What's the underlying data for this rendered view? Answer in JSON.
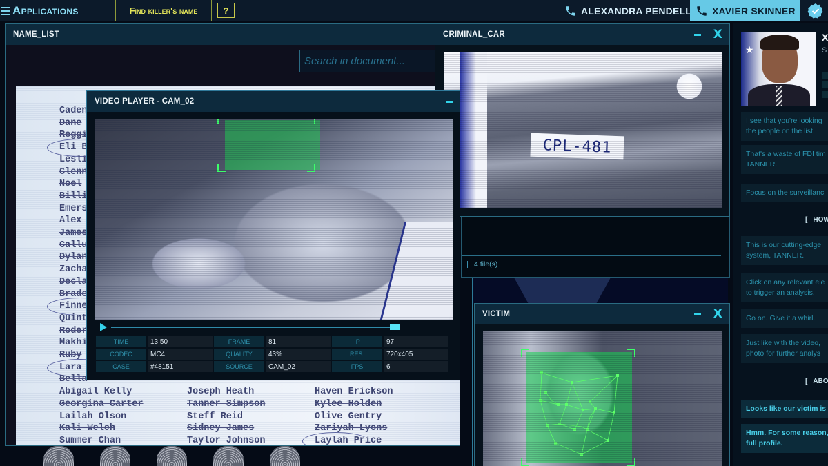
{
  "topbar": {
    "apps_label": "Applications",
    "task_label": "Find killer's name",
    "help_label": "?",
    "contacts": [
      {
        "name": "ALEXANDRA PENDELL",
        "active": false
      },
      {
        "name": "XAVIER SKINNER",
        "active": true
      }
    ],
    "accent_color": "#66c9e6",
    "task_color": "#e4e55a"
  },
  "name_list_window": {
    "title": "NAME_LIST",
    "search_placeholder": "Search in document...",
    "names_column_1": [
      "Caden",
      "Dane",
      "Reggi",
      "Eli B",
      "Lesli",
      "Glenn",
      "Noel",
      "Billi",
      "Emers",
      "Alex",
      "James",
      "Callu",
      "Dylan",
      "Zacha",
      "Decla",
      "Brade",
      "Finne",
      "Quint",
      "Roder",
      "Makhi",
      "Ruby",
      "Lara",
      "Bella"
    ],
    "circled_column_1": [
      "Eli B",
      "Finne",
      "Lara"
    ],
    "bottom_rows": [
      [
        "Abigail Kelly",
        "Joseph Heath",
        "Haven Erickson"
      ],
      [
        "Georgina Carter",
        "Tanner Simpson",
        "Kylee Holden"
      ],
      [
        "Lailah Olson",
        "Steff Reid",
        "Olive Gentry"
      ],
      [
        "Kali Welch",
        "Sidney James",
        "Zariyah Lyons"
      ],
      [
        "Summer Chan",
        "Taylor Johnson",
        "Laylah Price"
      ]
    ],
    "circled_bottom": [
      "Laylah Price"
    ]
  },
  "video_player": {
    "title": "VIDEO PLAYER - CAM_02",
    "progress": 1.0,
    "meta": [
      {
        "label": "TIME",
        "value": "13:50"
      },
      {
        "label": "FRAME",
        "value": "81"
      },
      {
        "label": "IP",
        "value": "97"
      },
      {
        "label": "CODEC",
        "value": "MC4"
      },
      {
        "label": "QUALITY",
        "value": "43%"
      },
      {
        "label": "RES.",
        "value": "720x405"
      },
      {
        "label": "CASE",
        "value": "#48151"
      },
      {
        "label": "SOURCE",
        "value": "CAM_02"
      },
      {
        "label": "FPS",
        "value": "6"
      }
    ]
  },
  "criminal_car_window": {
    "title": "CRIMINAL_CAR",
    "plate": "CPL-481",
    "minimize": "–",
    "close": "X"
  },
  "files_panel": {
    "count_label": "4 file(s)"
  },
  "victim_window": {
    "title": "VICTIM",
    "minimize": "–",
    "close": "X"
  },
  "chat": {
    "profile_name": "X",
    "profile_subtitle": "S",
    "messages_1": [
      "I see that you're looking\nthe people on the list.",
      "That's a waste of FDI tim\nTANNER.",
      "Focus on the surveillanc"
    ],
    "section_1": "HOW",
    "messages_2": [
      "This is our cutting-edge\nsystem, TANNER.",
      "Click on any relevant ele\nto trigger an analysis.",
      "Go on. Give it a whirl.",
      "Just like with the video,\nphoto for further analys"
    ],
    "section_2": "ABOUT",
    "messages_3": [
      "Looks like our victim is H",
      "Hmm. For some reason,\nfull profile."
    ]
  }
}
